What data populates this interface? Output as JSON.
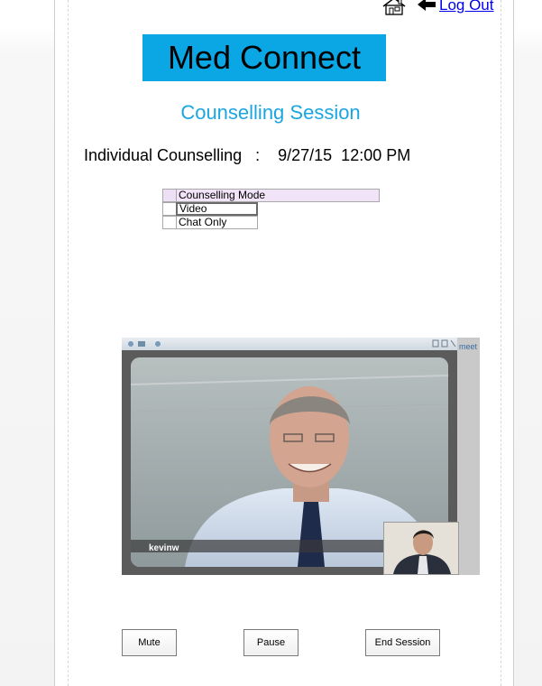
{
  "nav": {
    "home_icon": "home-icon",
    "back_icon": "back-arrow-icon",
    "logout_label": "Log Out"
  },
  "brand": {
    "name": "Med Connect",
    "color": "#0aa7e4"
  },
  "session": {
    "title": "Counselling Session",
    "title_color": "#1ba6df",
    "info": "Individual Counselling   :    9/27/15  12:00 PM"
  },
  "mode": {
    "header": "Counselling Mode",
    "options": [
      "Video",
      "Chat Only"
    ]
  },
  "video": {
    "caller_name": "kevinw",
    "side_label": "meet"
  },
  "controls": {
    "mute_label": "Mute",
    "pause_label": "Pause",
    "end_label": "End Session"
  }
}
